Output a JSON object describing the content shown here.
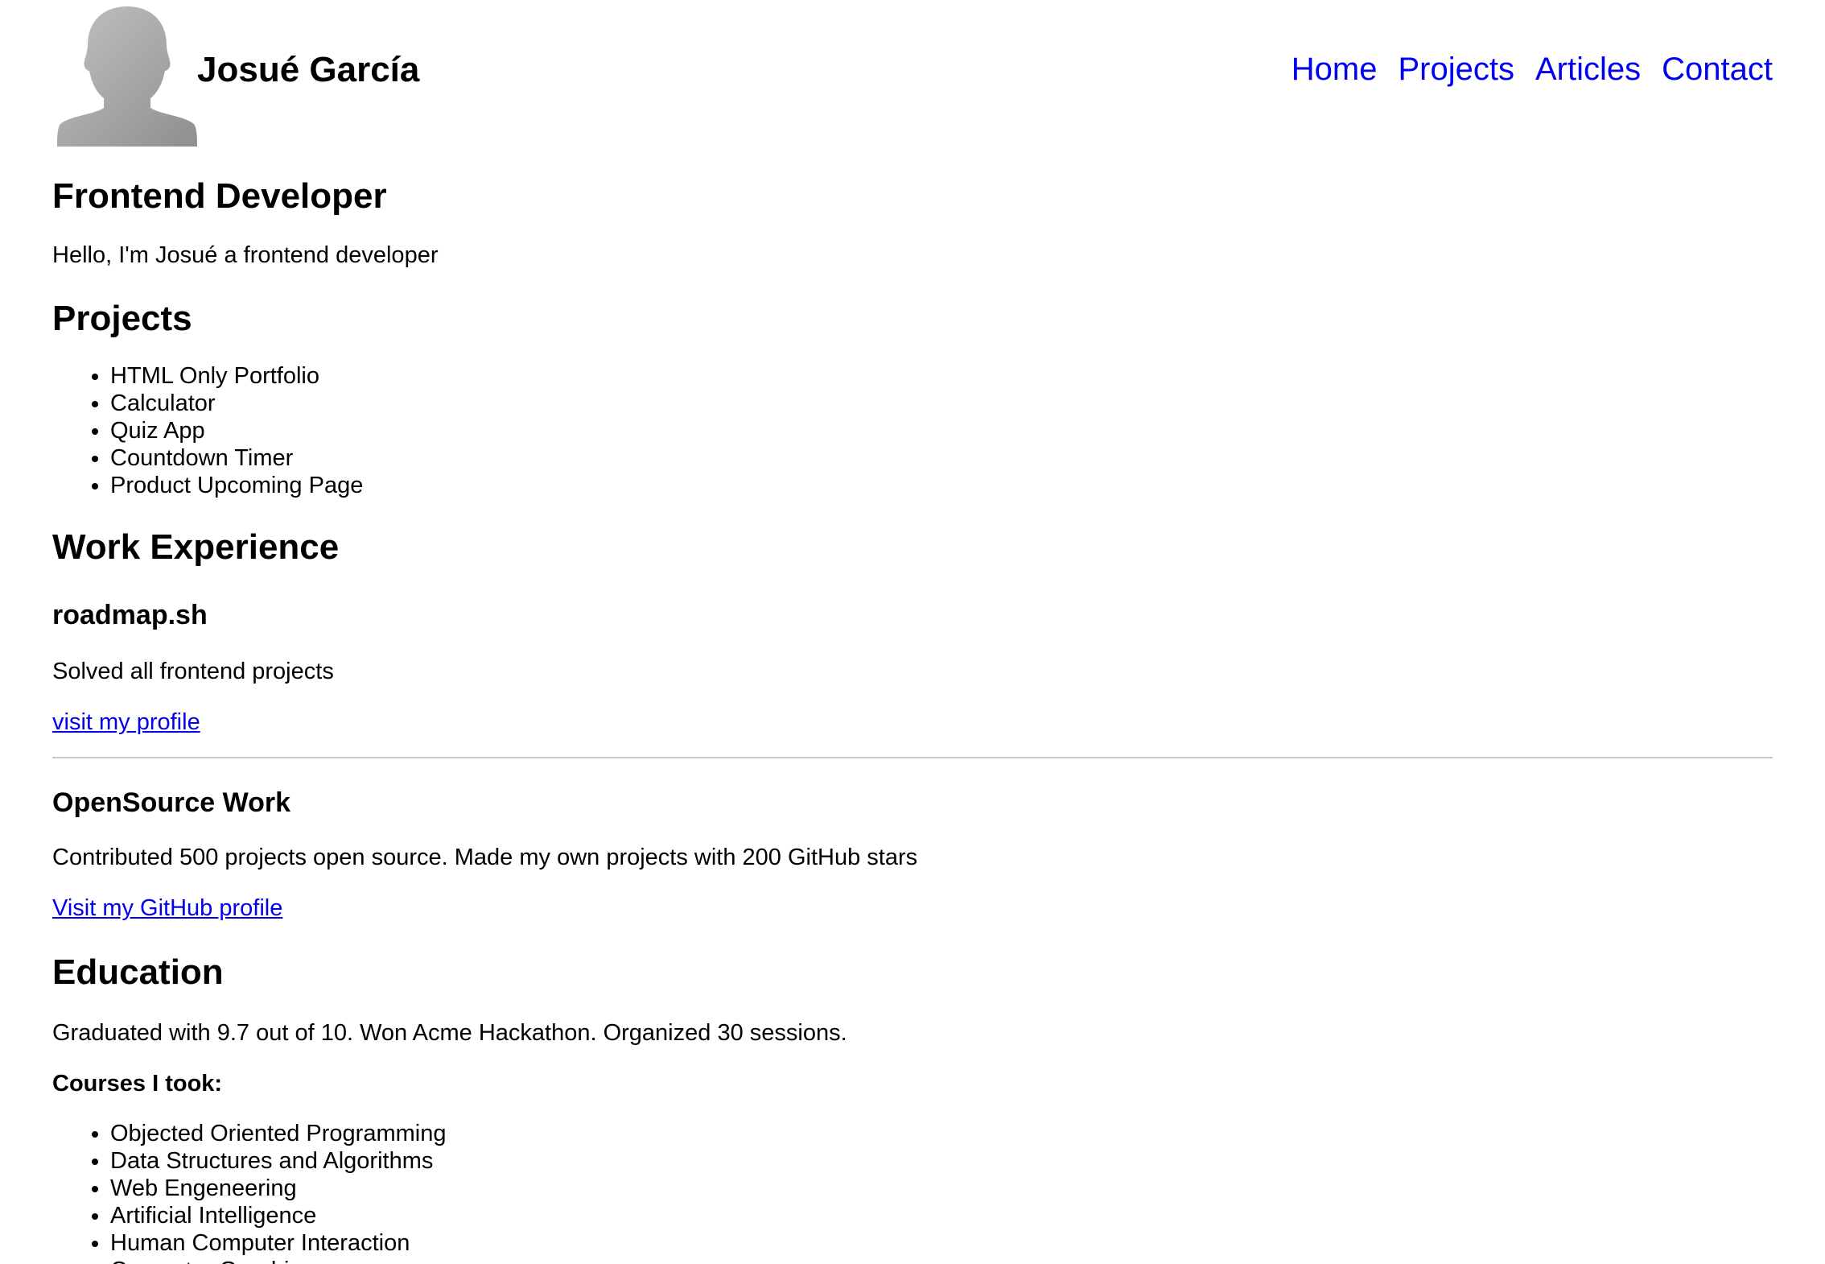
{
  "header": {
    "name": "Josué García",
    "nav": [
      "Home",
      "Projects",
      "Articles",
      "Contact"
    ]
  },
  "hero": {
    "title": "Frontend Developer",
    "intro": "Hello, I'm Josué a frontend developer"
  },
  "projects": {
    "title": "Projects",
    "items": [
      "HTML Only Portfolio",
      "Calculator",
      "Quiz App",
      "Countdown Timer",
      "Product Upcoming Page"
    ]
  },
  "work": {
    "title": "Work Experience",
    "jobs": [
      {
        "company": "roadmap.sh",
        "description": "Solved all frontend projects",
        "link_label": "visit my profile"
      },
      {
        "company": "OpenSource Work",
        "description": "Contributed 500 projects open source. Made my own projects with 200 GitHub stars",
        "link_label": "Visit my GitHub profile"
      }
    ]
  },
  "education": {
    "title": "Education",
    "summary": "Graduated with 9.7 out of 10. Won Acme Hackathon. Organized 30 sessions.",
    "courses_label": "Courses I took:",
    "courses": [
      "Objected Oriented Programming",
      "Data Structures and Algorithms",
      "Web Engeneering",
      "Artificial Intelligence",
      "Human Computer Interaction",
      "Computer Graphics"
    ]
  },
  "colors": {
    "link": "#0000ee",
    "divider": "#c8c8c8",
    "avatar_gray_top": "#b9b9b9",
    "avatar_gray_bottom": "#9a9a9a"
  },
  "icons": {
    "avatar": "person-silhouette-icon"
  }
}
